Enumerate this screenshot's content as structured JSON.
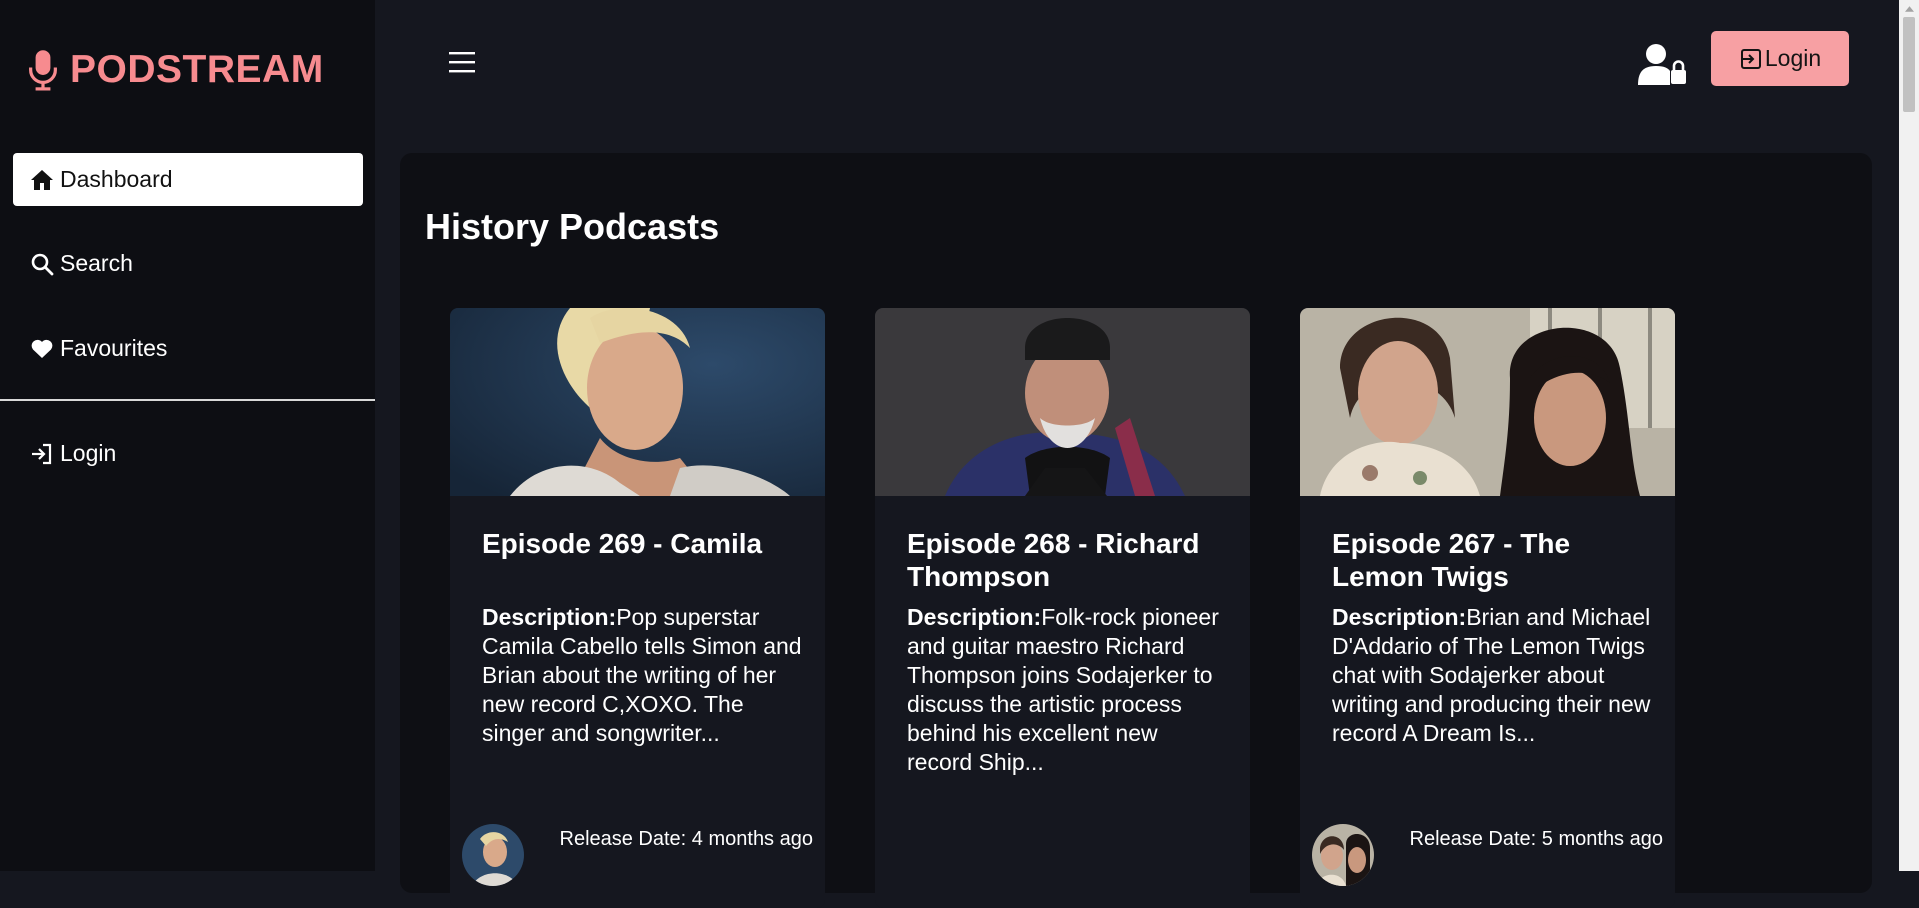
{
  "app": {
    "brand": "PODSTREAM",
    "brand_color": "#f78b8f"
  },
  "sidebar": {
    "items": [
      {
        "label": "Dashboard",
        "icon": "home-icon",
        "active": true
      },
      {
        "label": "Search",
        "icon": "search-icon",
        "active": false
      },
      {
        "label": "Favourites",
        "icon": "heart-icon",
        "active": false
      },
      {
        "label": "Login",
        "icon": "login-icon",
        "active": false
      }
    ]
  },
  "header": {
    "login_label": "Login",
    "login_bg": "#f7a0a3"
  },
  "main": {
    "section_title": "History Podcasts",
    "cards": [
      {
        "title": "Episode 269 - Camila",
        "desc_label": "Description:",
        "description": "Pop superstar Camila Cabello tells Simon and Brian about the writing of her new record C,XOXO. The singer and songwriter...",
        "release": "Release Date: 4 months ago"
      },
      {
        "title": "Episode 268 - Richard Thompson",
        "desc_label": "Description:",
        "description": "Folk-rock pioneer and guitar maestro Richard Thompson joins Sodajerker to discuss the artistic process behind his excellent new record Ship...",
        "release": ""
      },
      {
        "title": "Episode 267 - The Lemon Twigs",
        "desc_label": "Description:",
        "description": "Brian and Michael D'Addario of The Lemon Twigs chat with Sodajerker about writing and producing their new record A Dream Is...",
        "release": "Release Date: 5 months ago"
      }
    ]
  }
}
